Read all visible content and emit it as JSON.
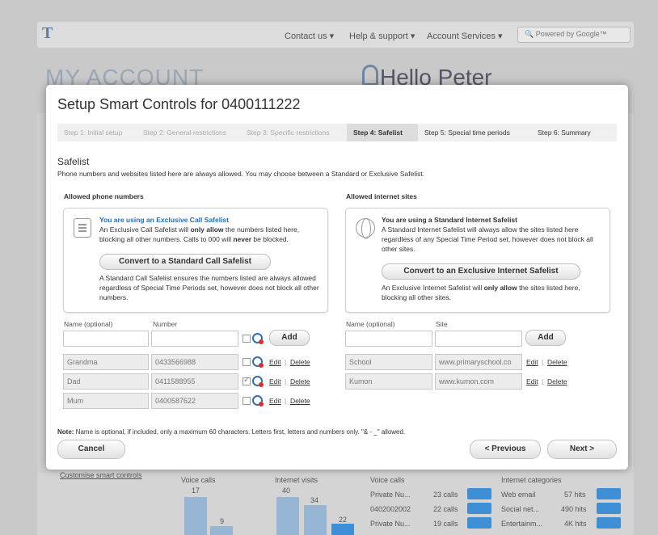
{
  "background": {
    "nav": [
      "Contact us ▾",
      "Help & support ▾",
      "Account Services ▾"
    ],
    "search_placeholder": "Powered by Google™",
    "my_account": "MY ACCOUNT",
    "hello": "Hello Peter",
    "lower_link": "Customise smart controls",
    "voice_calls_col": "Voice calls",
    "internet_visits_col": "Internet visits",
    "bar_labels": [
      "17",
      "9",
      "40",
      "34",
      "22"
    ],
    "voice_list_head": "Voice calls",
    "voice_list": [
      {
        "name": "Private Nu...",
        "value": "23 calls"
      },
      {
        "name": "0402002002",
        "value": "22 calls"
      },
      {
        "name": "Private Nu...",
        "value": "19 calls"
      }
    ],
    "internet_list_head": "Internet categories",
    "internet_list": [
      {
        "name": "Web email",
        "value": "57 hits"
      },
      {
        "name": "Social net...",
        "value": "490 hits"
      },
      {
        "name": "Entertainm...",
        "value": "4K hits"
      }
    ]
  },
  "modal": {
    "title": "Setup Smart Controls for 0400111222",
    "steps": [
      {
        "label": "Step 1: Initial setup",
        "state": "done"
      },
      {
        "label": "Step 2: General restrictions",
        "state": "done"
      },
      {
        "label": "Step 3: Specific restrictions",
        "state": "done"
      },
      {
        "label": "Step 4: Safelist",
        "state": "active"
      },
      {
        "label": "Step 5: Special time periods",
        "state": "future"
      },
      {
        "label": "Step 6: Summary",
        "state": "future"
      }
    ],
    "section_title": "Safelist",
    "section_desc": "Phone numbers and websites listed here are always allowed. You may choose between a Standard or Exclusive Safelist.",
    "phone": {
      "heading": "Allowed phone numbers",
      "info_head": "You are using an Exclusive Call Safelist",
      "info_pre": "An Exclusive Call Safelist will ",
      "info_bold1": "only allow",
      "info_mid": " the numbers listed here, blocking all other numbers. Calls to 000 will ",
      "info_bold2": "never",
      "info_post": " be blocked.",
      "convert_label": "Convert to a Standard Call Safelist",
      "info_bottom": "A Standard Call Safelist ensures the numbers listed are always allowed regardless of Special Time Periods set, however does not block all other numbers.",
      "name_label": "Name (optional)",
      "number_label": "Number",
      "add_label": "Add",
      "rows": [
        {
          "name": "Grandma",
          "number": "0433566988",
          "checked": false
        },
        {
          "name": "Dad",
          "number": "0411588955",
          "checked": true
        },
        {
          "name": "Mum",
          "number": "0400587622",
          "checked": false
        }
      ],
      "edit_label": "Edit",
      "delete_label": "Delete"
    },
    "internet": {
      "heading": "Allowed internet sites",
      "info_head": "You are using a Standard Internet Safelist",
      "info_body": "A Standard Internet Safelist will always allow the sites listed here regardless of any Special Time Period set, however does not block all other sites.",
      "convert_label": "Convert to an Exclusive Internet Safelist",
      "info_bottom_pre": "An Exclusive Internet Safelist will ",
      "info_bottom_bold": "only allow",
      "info_bottom_post": " the sites listed here, blocking all other sites.",
      "name_label": "Name (optional)",
      "site_label": "Site",
      "add_label": "Add",
      "rows": [
        {
          "name": "School",
          "site": "www.primaryschool.co"
        },
        {
          "name": "Kumon",
          "site": "www.kumon.com"
        }
      ],
      "edit_label": "Edit",
      "delete_label": "Delete"
    },
    "note_bold": "Note:",
    "note_text": " Name is optional, if included, only a maximum 60 characters. Letters first, letters and numbers only. \"& - _\" allowed.",
    "cancel_label": "Cancel",
    "previous_label": "< Previous",
    "next_label": "Next >"
  }
}
